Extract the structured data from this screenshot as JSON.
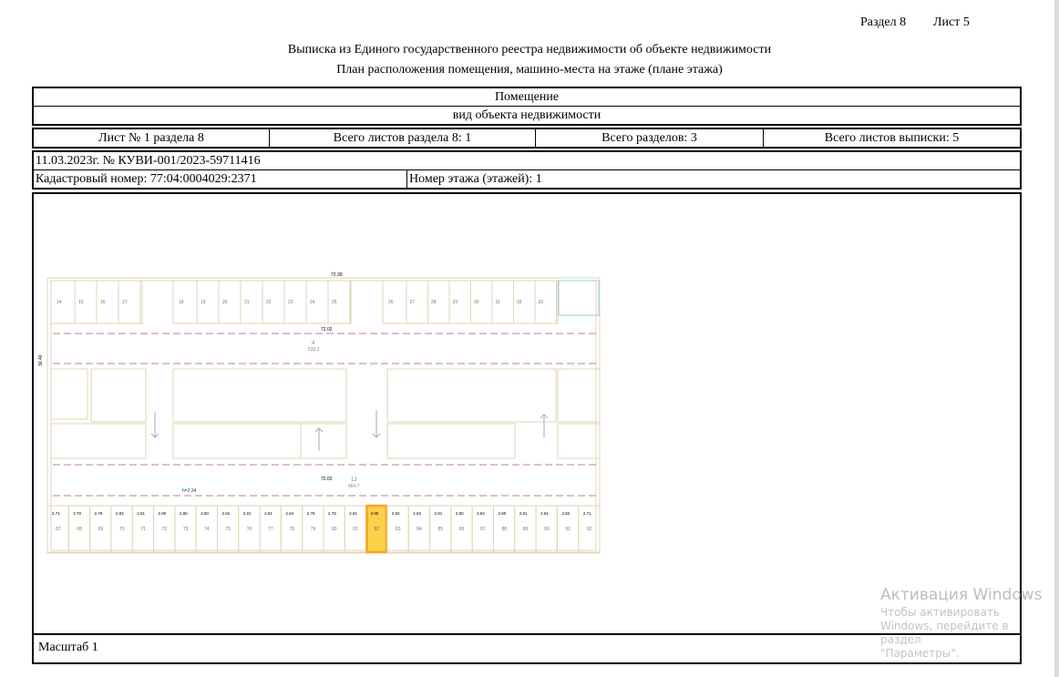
{
  "header": {
    "section": "Раздел 8",
    "sheet": "Лист 5"
  },
  "title": "Выписка из Единого государственного реестра недвижимости об объекте недвижимости",
  "subtitle": "План расположения помещения, машино-места на этаже (плане этажа)",
  "object": {
    "name": "Помещение",
    "type_label": "вид объекта недвижимости"
  },
  "sheet_info": {
    "sheet_no": "Лист № 1 раздела 8",
    "section_sheets": "Всего листов раздела 8: 1",
    "sections_total": "Всего разделов: 3",
    "extract_sheets": "Всего листов выписки: 5"
  },
  "record": {
    "date_number": "11.03.2023г. № КУВИ-001/2023-59711416",
    "cadastral": "Кадастровый номер: 77:04:0004029:2371",
    "floor": "Номер этажа (этажей): 1"
  },
  "scale": "Масштаб 1",
  "plan": {
    "total_width": "72.39",
    "inner_width": "72.02",
    "inner_width2": "72.02",
    "height_dim": "30.40",
    "ceiling": "h=2.34",
    "room13": "13",
    "room13_area": "484.7",
    "room4": "4",
    "room4_area": "520.2",
    "top_spaces": [
      "14",
      "15",
      "16",
      "17",
      "18",
      "19",
      "20",
      "21",
      "22",
      "23",
      "24",
      "25",
      "26",
      "27",
      "28",
      "29",
      "30",
      "31",
      "32",
      "33"
    ],
    "bottom_spaces": [
      "67",
      "68",
      "69",
      "70",
      "71",
      "72",
      "73",
      "74",
      "75",
      "76",
      "77",
      "78",
      "79",
      "80",
      "81",
      "82",
      "83",
      "84",
      "85",
      "86",
      "87",
      "88",
      "89",
      "90",
      "91",
      "92"
    ],
    "bottom_widths": [
      "2.71",
      "2.79",
      "2.79",
      "2.82",
      "2.81",
      "2.80",
      "2.80",
      "2.80",
      "2.81",
      "2.81",
      "2.81",
      "2.84",
      "2.79",
      "2.78",
      "2.81",
      "2.85",
      "2.82",
      "2.82",
      "2.81",
      "2.80",
      "2.82",
      "2.80",
      "2.81",
      "2.81",
      "2.82",
      "2.71"
    ],
    "highlighted_space": "82",
    "highlight_color": "#f5a623",
    "line_color": "#e2d6b4",
    "label_color": "#c58aa6"
  },
  "watermark": {
    "title": "Активация Windows",
    "line1": "Чтобы активировать Windows, перейдите в раздел",
    "line2": "\"Параметры\"."
  }
}
